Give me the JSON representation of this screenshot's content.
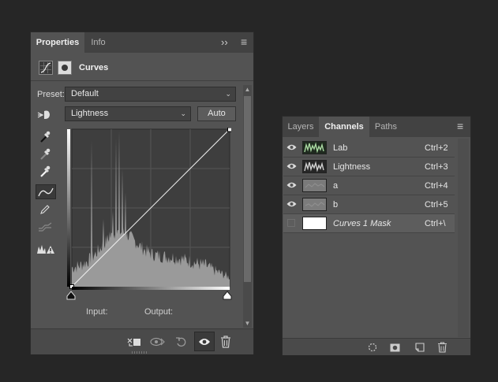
{
  "properties_panel": {
    "tabs": [
      {
        "label": "Properties"
      },
      {
        "label": "Info"
      }
    ],
    "panel_title": "Curves",
    "preset_label": "Preset:",
    "preset_value": "Default",
    "channel_value": "Lightness",
    "auto_label": "Auto",
    "input_label": "Input:",
    "output_label": "Output:",
    "menu_glyph": "≡",
    "collapse_glyph": "››"
  },
  "channels_panel": {
    "tabs": [
      {
        "label": "Layers"
      },
      {
        "label": "Channels"
      },
      {
        "label": "Paths"
      }
    ],
    "menu_glyph": "≡",
    "rows": [
      {
        "name": "Lab",
        "shortcut": "Ctrl+2"
      },
      {
        "name": "Lightness",
        "shortcut": "Ctrl+3"
      },
      {
        "name": "a",
        "shortcut": "Ctrl+4"
      },
      {
        "name": "b",
        "shortcut": "Ctrl+5"
      },
      {
        "name": "Curves 1 Mask",
        "shortcut": "Ctrl+\\"
      }
    ]
  },
  "colors": {
    "app_bg": "#262626",
    "panel_bg": "#535353",
    "tabbar_bg": "#424242",
    "graph_bg": "#3e3e3e",
    "histogram": "#9a9a9a",
    "highlight_row": "#5d5d5d"
  }
}
